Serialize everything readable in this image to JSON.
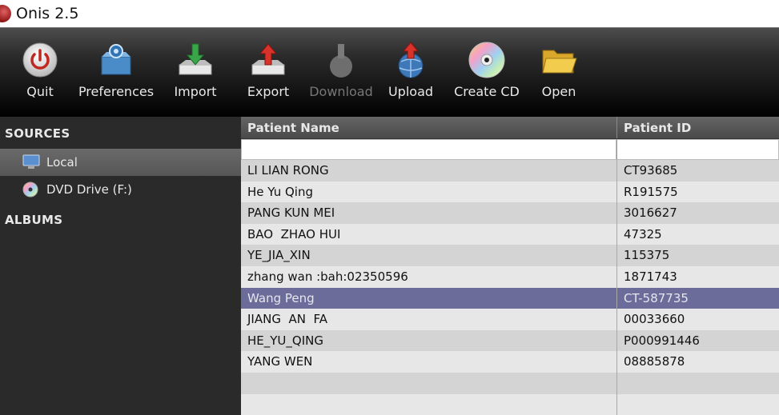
{
  "window": {
    "title": "Onis 2.5"
  },
  "toolbar": {
    "buttons": [
      {
        "label": "Quit",
        "icon": "power-icon",
        "enabled": true
      },
      {
        "label": "Preferences",
        "icon": "gear-box-icon",
        "enabled": true
      },
      {
        "label": "Import",
        "icon": "import-arrow-icon",
        "enabled": true
      },
      {
        "label": "Export",
        "icon": "export-arrow-icon",
        "enabled": true
      },
      {
        "label": "Download",
        "icon": "download-icon",
        "enabled": false
      },
      {
        "label": "Upload",
        "icon": "upload-globe-icon",
        "enabled": true
      },
      {
        "label": "Create CD",
        "icon": "cd-icon",
        "enabled": true
      },
      {
        "label": "Open",
        "icon": "folder-icon",
        "enabled": true
      }
    ]
  },
  "sidebar": {
    "sources_heading": "SOURCES",
    "sources": [
      {
        "label": "Local",
        "icon": "monitor-icon",
        "selected": true
      },
      {
        "label": "DVD Drive (F:)",
        "icon": "dvd-icon",
        "selected": false
      }
    ],
    "albums_heading": "ALBUMS"
  },
  "table": {
    "columns": [
      "Patient Name",
      "Patient ID"
    ],
    "filter_values": [
      "",
      ""
    ],
    "rows": [
      {
        "name": "LI LIAN RONG",
        "id": "CT93685"
      },
      {
        "name": "He Yu Qing",
        "id": "R191575"
      },
      {
        "name": "PANG KUN MEI",
        "id": "3016627"
      },
      {
        "name": "BAO  ZHAO HUI",
        "id": "47325"
      },
      {
        "name": "YE_JIA_XIN",
        "id": "115375"
      },
      {
        "name": "zhang wan :bah:02350596",
        "id": "1871743"
      },
      {
        "name": "Wang Peng",
        "id": "CT-587735"
      },
      {
        "name": "JIANG  AN  FA",
        "id": "00033660"
      },
      {
        "name": "HE_YU_QING",
        "id": "P000991446"
      },
      {
        "name": "YANG WEN",
        "id": "08885878"
      }
    ],
    "selected_row": 6
  }
}
